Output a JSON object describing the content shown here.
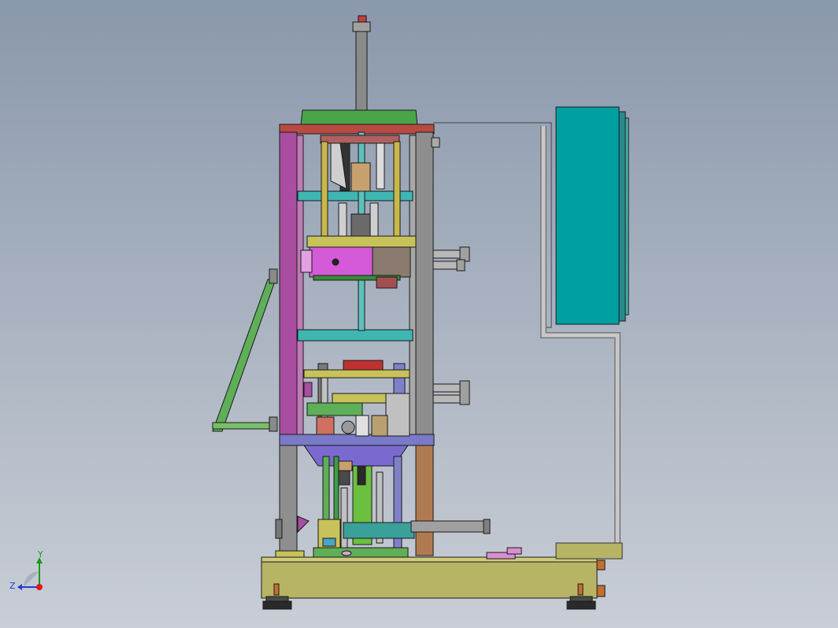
{
  "viewport": {
    "background_top": "#8a98ab",
    "background_bottom": "#c9ced6"
  },
  "triad": {
    "x_label": "",
    "y_label": "Y",
    "z_label": "Z",
    "x_color": "#d81b1b",
    "y_color": "#1a9a1a",
    "z_color": "#1b3fd8"
  },
  "model": {
    "frame_purple": "#a84ea0",
    "frame_gray": "#8e8e8e",
    "frame_orange": "#b07a50",
    "frame_green": "#3aa040",
    "base_yellow": "#b8b465",
    "cabinet_teal": "#00a0a0",
    "rod_teal": "#3fb6b2",
    "magenta_block": "#d45ad8",
    "top_plate_red": "#b84a42",
    "top_plate_green": "#4aa548"
  }
}
